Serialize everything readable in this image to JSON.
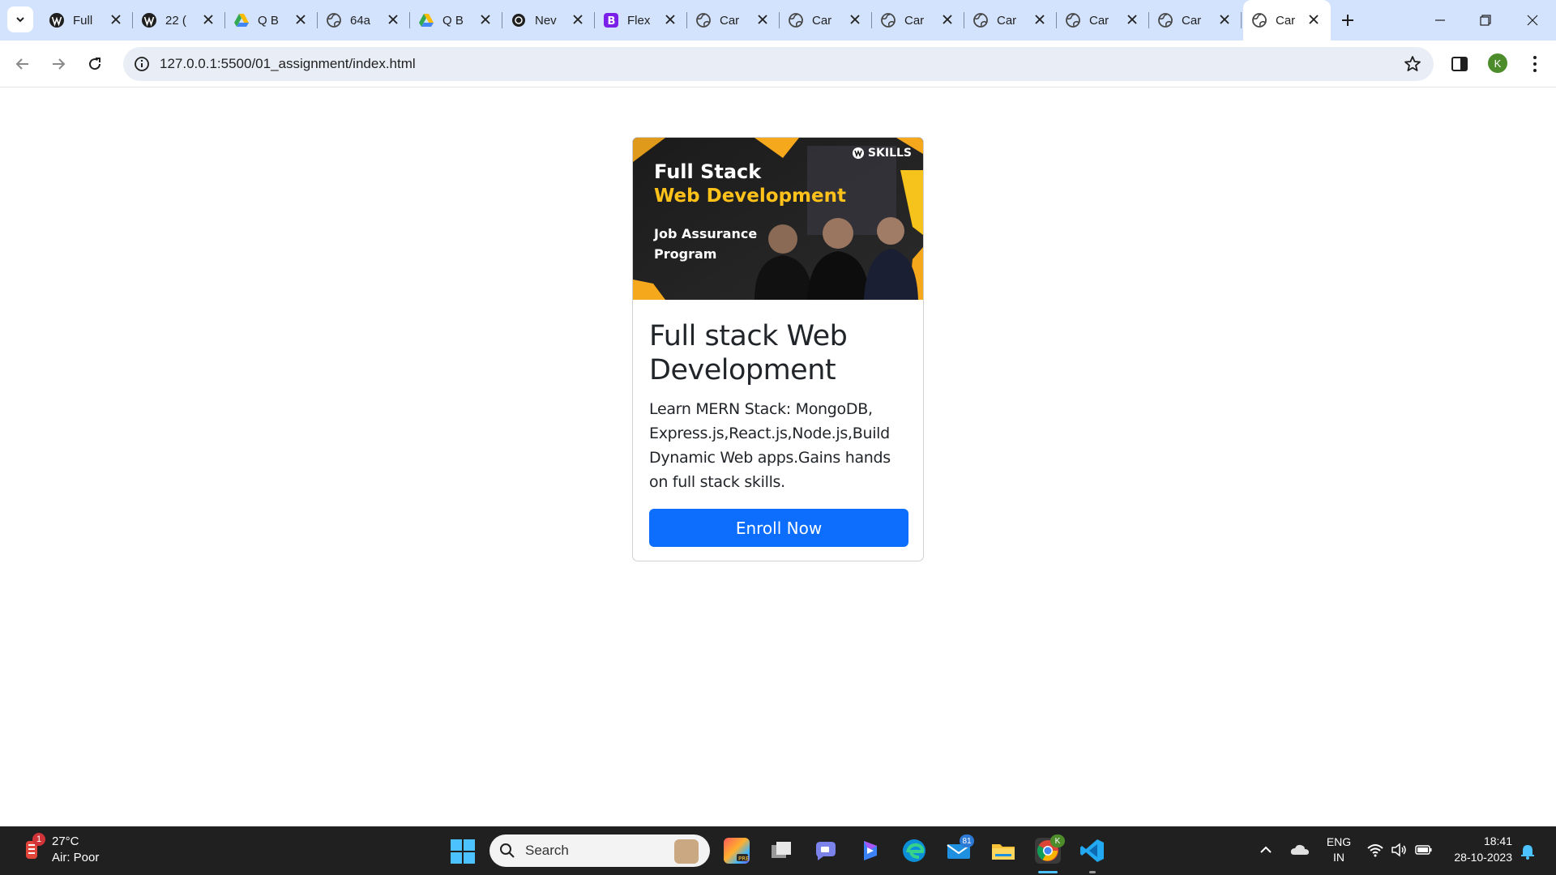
{
  "browser": {
    "tabs": [
      {
        "title": "Full",
        "favicon": "wordpress-icon",
        "active": false
      },
      {
        "title": "22 (",
        "favicon": "wordpress-icon",
        "active": false
      },
      {
        "title": "Q B",
        "favicon": "google-drive-icon",
        "active": false
      },
      {
        "title": "64a",
        "favicon": "globe-icon",
        "active": false
      },
      {
        "title": "Q B",
        "favicon": "google-drive-icon",
        "active": false
      },
      {
        "title": "Nev",
        "favicon": "openai-icon",
        "active": false
      },
      {
        "title": "Flex",
        "favicon": "bootstrap-icon",
        "active": false
      },
      {
        "title": "Car",
        "favicon": "globe-icon",
        "active": false
      },
      {
        "title": "Car",
        "favicon": "globe-icon",
        "active": false
      },
      {
        "title": "Car",
        "favicon": "globe-icon",
        "active": false
      },
      {
        "title": "Car",
        "favicon": "globe-icon",
        "active": false
      },
      {
        "title": "Car",
        "favicon": "globe-icon",
        "active": false
      },
      {
        "title": "Car",
        "favicon": "globe-icon",
        "active": false
      },
      {
        "title": "Car",
        "favicon": "globe-icon",
        "active": true
      }
    ],
    "address": "127.0.0.1:5500/01_assignment/index.html",
    "profile_initial": "K"
  },
  "card": {
    "banner": {
      "line1": "Full Stack",
      "line2": "Web Development",
      "line3": "Job Assurance Program",
      "brand": "SKILLS"
    },
    "title": "Full stack Web Development",
    "text": "Learn MERN Stack: MongoDB, Express.js,React.js,Node.js,Build Dynamic Web apps.Gains hands on full stack skills.",
    "button_label": "Enroll Now"
  },
  "taskbar": {
    "weather_badge": "1",
    "weather_temp": "27°C",
    "weather_air": "Air: Poor",
    "search_placeholder": "Search",
    "mail_badge": "81",
    "chrome_badge": "K",
    "lang_line1": "ENG",
    "lang_line2": "IN",
    "time": "18:41",
    "date": "28-10-2023"
  },
  "colors": {
    "tabstrip": "#d3e3fd",
    "button": "#0d6efd",
    "taskbar": "#202020"
  }
}
